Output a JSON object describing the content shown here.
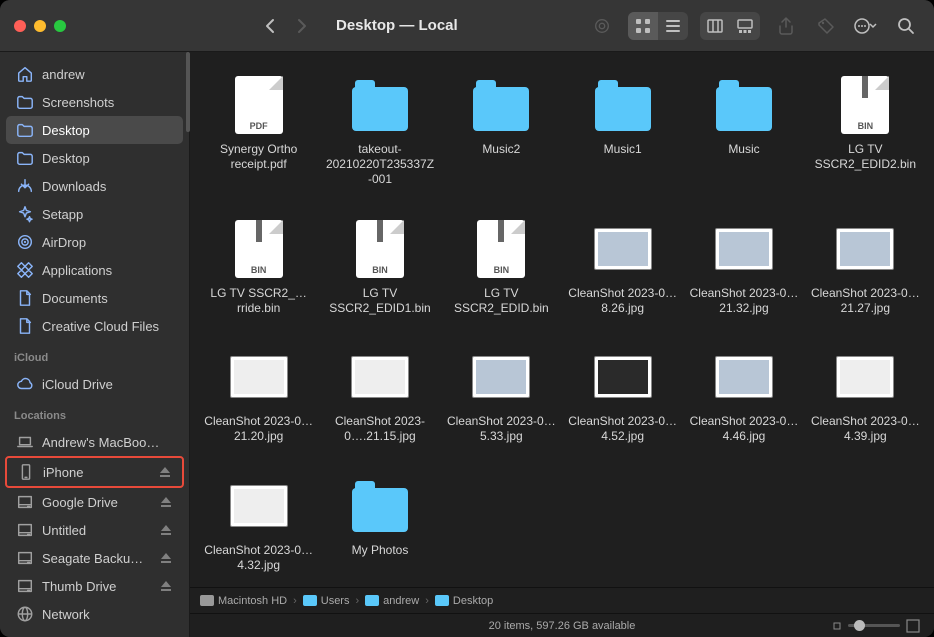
{
  "window": {
    "title": "Desktop — Local"
  },
  "sidebar": {
    "favorites": [
      {
        "id": "andrew",
        "label": "andrew",
        "icon": "home"
      },
      {
        "id": "screens",
        "label": "Screenshots",
        "icon": "folder"
      },
      {
        "id": "desk1",
        "label": "Desktop",
        "icon": "folder",
        "selected": true
      },
      {
        "id": "desk2",
        "label": "Desktop",
        "icon": "folder"
      },
      {
        "id": "dl",
        "label": "Downloads",
        "icon": "download"
      },
      {
        "id": "setapp",
        "label": "Setapp",
        "icon": "sparkle"
      },
      {
        "id": "airdrop",
        "label": "AirDrop",
        "icon": "airdrop"
      },
      {
        "id": "apps",
        "label": "Applications",
        "icon": "apps"
      },
      {
        "id": "docs",
        "label": "Documents",
        "icon": "doc"
      },
      {
        "id": "cc",
        "label": "Creative Cloud Files",
        "icon": "doc"
      }
    ],
    "icloud_heading": "iCloud",
    "icloud": [
      {
        "id": "icd",
        "label": "iCloud Drive",
        "icon": "cloud"
      }
    ],
    "locations_heading": "Locations",
    "locations": [
      {
        "id": "mbp",
        "label": "Andrew's MacBoo…",
        "icon": "laptop"
      },
      {
        "id": "iph",
        "label": "iPhone",
        "icon": "phone",
        "eject": true,
        "highlight": true
      },
      {
        "id": "gd",
        "label": "Google Drive",
        "icon": "disk",
        "eject": true
      },
      {
        "id": "unt",
        "label": "Untitled",
        "icon": "disk",
        "eject": true
      },
      {
        "id": "sea",
        "label": "Seagate Backu…",
        "icon": "disk",
        "eject": true
      },
      {
        "id": "thumb",
        "label": "Thumb Drive",
        "icon": "disk",
        "eject": true
      },
      {
        "id": "net",
        "label": "Network",
        "icon": "globe"
      }
    ]
  },
  "files": [
    {
      "label": "Synergy Ortho receipt.pdf",
      "kind": "pdf"
    },
    {
      "label": "takeout-20210220T235337Z-001",
      "kind": "folder"
    },
    {
      "label": "Music2",
      "kind": "folder"
    },
    {
      "label": "Music1",
      "kind": "folder"
    },
    {
      "label": "Music",
      "kind": "folder"
    },
    {
      "label": "LG TV SSCR2_EDID2.bin",
      "kind": "bin"
    },
    {
      "label": "LG TV SSCR2_…rride.bin",
      "kind": "bin"
    },
    {
      "label": "LG TV SSCR2_EDID1.bin",
      "kind": "bin"
    },
    {
      "label": "LG TV SSCR2_EDID.bin",
      "kind": "bin"
    },
    {
      "label": "CleanShot 2023-0…8.26.jpg",
      "kind": "pic"
    },
    {
      "label": "CleanShot 2023-0…21.32.jpg",
      "kind": "pic"
    },
    {
      "label": "CleanShot 2023-0…21.27.jpg",
      "kind": "pic"
    },
    {
      "label": "CleanShot 2023-0…21.20.jpg",
      "kind": "picdoc"
    },
    {
      "label": "CleanShot 2023-0….21.15.jpg",
      "kind": "picdoc"
    },
    {
      "label": "CleanShot 2023-0…5.33.jpg",
      "kind": "pic"
    },
    {
      "label": "CleanShot 2023-0…4.52.jpg",
      "kind": "picdark"
    },
    {
      "label": "CleanShot 2023-0…4.46.jpg",
      "kind": "pic"
    },
    {
      "label": "CleanShot 2023-0…4.39.jpg",
      "kind": "picdoc"
    },
    {
      "label": "CleanShot 2023-0…4.32.jpg",
      "kind": "picdoc"
    },
    {
      "label": "My Photos",
      "kind": "folder"
    }
  ],
  "path": [
    {
      "label": "Macintosh HD",
      "icon": "hd"
    },
    {
      "label": "Users",
      "icon": "fd"
    },
    {
      "label": "andrew",
      "icon": "fd"
    },
    {
      "label": "Desktop",
      "icon": "fd"
    }
  ],
  "status": {
    "text": "20 items, 597.26 GB available"
  }
}
